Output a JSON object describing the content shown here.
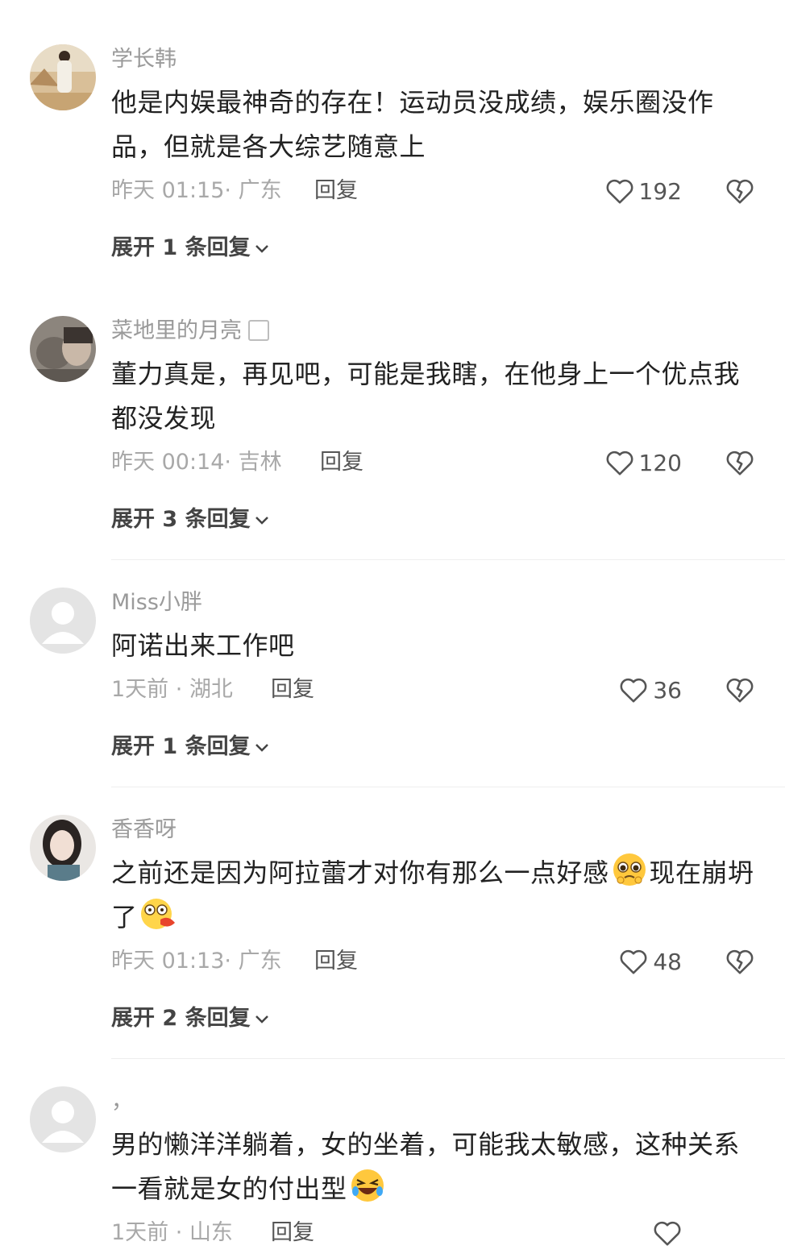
{
  "comments": [
    {
      "username": "学长韩",
      "content": "他是内娱最神奇的存在！运动员没成绩，娱乐圈没作品，但就是各大综艺随意上",
      "time": "昨天 01:15",
      "location": "广东",
      "reply_label": "回复",
      "likes": "192",
      "expand_label": "展开 1 条回复"
    },
    {
      "username": "菜地里的月亮",
      "content": "董力真是，再见吧，可能是我瞎，在他身上一个优点我都没发现",
      "time": "昨天 00:14",
      "location": "吉林",
      "reply_label": "回复",
      "likes": "120",
      "expand_label": "展开 3 条回复"
    },
    {
      "username": "Miss小胖",
      "content": "阿诺出来工作吧",
      "time": "1天前",
      "location": "湖北",
      "reply_label": "回复",
      "likes": "36",
      "expand_label": "展开 1 条回复"
    },
    {
      "username": "香香呀",
      "content_part1": "之前还是因为阿拉蕾才对你有那么一点好感",
      "content_part2": "现在崩坍了",
      "time": "昨天 01:13",
      "location": "广东",
      "reply_label": "回复",
      "likes": "48",
      "expand_label": "展开 2 条回复"
    },
    {
      "username": "，",
      "content": "男的懒洋洋躺着，女的坐着，可能我太敏感，这种关系一看就是女的付出型",
      "time": "1天前",
      "location": "山东",
      "reply_label": "回复"
    }
  ],
  "colors": {
    "text_primary": "#222222",
    "text_secondary": "#a8a8a8",
    "divider": "#eeeeee"
  },
  "icons": [
    "heart-outline-icon",
    "broken-heart-icon",
    "chevron-down-icon",
    "default-avatar-icon",
    "pleading-face-emoji",
    "dizzy-face-emoji",
    "rolling-laughing-emoji"
  ]
}
